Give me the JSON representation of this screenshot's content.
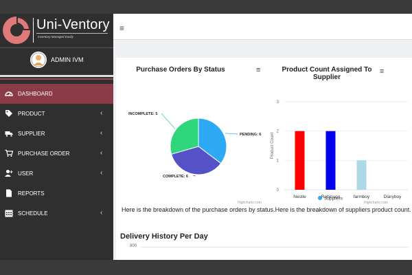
{
  "app": {
    "name": "Uni-Ventory",
    "tagline": "Inventory Managed Easily",
    "colors": {
      "accent": "#8b3a47",
      "logo": "#e07a7a",
      "sidebar": "#2f2f2f"
    }
  },
  "user": {
    "name": "ADMIN IVM"
  },
  "nav": {
    "items": [
      {
        "label": "DASHBOARD",
        "icon": "dashboard-icon",
        "has_chevron": false
      },
      {
        "label": "PRODUCT",
        "icon": "tag-icon",
        "has_chevron": true
      },
      {
        "label": "SUPPLIER",
        "icon": "truck-icon",
        "has_chevron": true
      },
      {
        "label": "PURCHASE ORDER",
        "icon": "cart-icon",
        "has_chevron": true
      },
      {
        "label": "USER",
        "icon": "user-plus-icon",
        "has_chevron": true
      },
      {
        "label": "REPORTS",
        "icon": "file-icon",
        "has_chevron": false
      },
      {
        "label": "SCHEDULE",
        "icon": "calendar-icon",
        "has_chevron": true
      }
    ]
  },
  "header": {
    "menu_icon": "hamburger-icon"
  },
  "charts": {
    "caption": "Here is the breakdown of the purchase orders by status.Here is the breakdown of suppliers product count.",
    "credits": "Highcharts.com",
    "menu_glyph": "≡",
    "chevron_glyph": "‹"
  },
  "delivery": {
    "title": "Delivery History Per Day",
    "ytick": "800"
  },
  "chart_data": [
    {
      "type": "pie",
      "title": "Purchase Orders By Status",
      "slices": [
        {
          "label": "PENDING: 6",
          "name": "PENDING",
          "value": 6,
          "color": "#2eaaf5"
        },
        {
          "label": "COMPLETE: 6",
          "name": "COMPLETE",
          "value": 6,
          "color": "#5552c8"
        },
        {
          "label": "INCOMPLETE: 5",
          "name": "INCOMPLETE",
          "value": 5,
          "color": "#2fd67b"
        }
      ]
    },
    {
      "type": "bar",
      "title": "Product Count Assigned To Supplier",
      "ylabel": "Product Count",
      "ylim": [
        0,
        3
      ],
      "yticks": [
        0,
        1,
        2,
        3
      ],
      "categories": [
        "Nestle",
        "Robinson",
        "farmboy",
        "Diaryboy"
      ],
      "values": [
        2,
        2,
        1,
        0
      ],
      "colors": [
        "#ff0000",
        "#0000ee",
        "#add8e6",
        "#cccccc"
      ],
      "legend": "Suppliers",
      "legend_color": "#2eaaf5"
    }
  ]
}
